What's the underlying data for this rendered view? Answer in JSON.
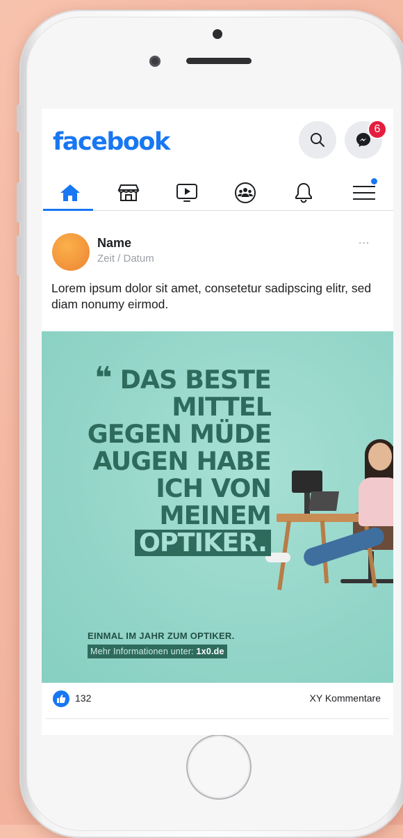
{
  "header": {
    "logo": "facebook",
    "messenger_badge": "6"
  },
  "nav": {
    "items": [
      {
        "name": "home",
        "icon": "home-icon",
        "active": true
      },
      {
        "name": "marketplace",
        "icon": "store-icon"
      },
      {
        "name": "watch",
        "icon": "video-icon"
      },
      {
        "name": "groups",
        "icon": "groups-icon"
      },
      {
        "name": "notifications",
        "icon": "bell-icon"
      },
      {
        "name": "menu",
        "icon": "hamburger-icon"
      }
    ]
  },
  "post": {
    "author": "Name",
    "time": "Zeit / Datum",
    "more": "...",
    "text": "Lorem ipsum dolor sit amet, consetetur sadipscing elitr, sed diam nonumy eirmod.",
    "ad": {
      "headline": [
        "DAS BESTE",
        "MITTEL",
        "GEGEN MÜDE",
        "AUGEN HABE",
        "ICH VON",
        "MEINEM",
        "OPTIKER."
      ],
      "tagline": "EINMAL IM JAHR ZUM OPTIKER.",
      "info_prefix": "Mehr Informationen unter:",
      "info_link": "1x0.de"
    },
    "likes": "132",
    "comments": "XY Kommentare"
  },
  "colors": {
    "facebook_blue": "#1877f2",
    "ad_background": "#92d5c8",
    "ad_text": "#2e6b5d",
    "badge_red": "#e41e3f",
    "avatar_orange": "#f1913b",
    "page_background": "#f3b6a0"
  }
}
